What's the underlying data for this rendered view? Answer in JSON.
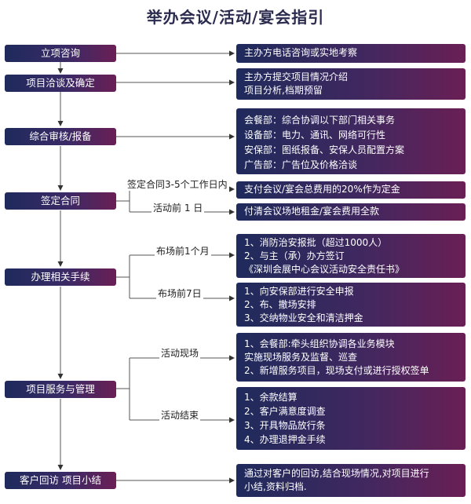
{
  "title": "举办会议/活动/宴会指引",
  "stages": {
    "s1": "立项咨询",
    "s2": "项目洽谈及确定",
    "s3": "综合审核/报备",
    "s4": "签定合同",
    "s5": "办理相关手续",
    "s6": "项目服务与管理",
    "s7": "客户回访  项目小结"
  },
  "boxes": {
    "b1": [
      "主办方电话咨询或实地考察"
    ],
    "b2": [
      "主办方提交项目情况介绍",
      "项目分析,档期预留"
    ],
    "b3": [
      "会餐部：综合协调以下部门相关事务",
      "设备部：电力、通讯、网络可行性",
      "安保部：图纸报备、安保人员配置方案",
      "广告部：广告位及价格洽谈"
    ],
    "b4": [
      "支付会议/宴会总费用的20%作为定金"
    ],
    "b5": [
      "付清会议场地租金/宴会费用全款"
    ],
    "b6": [
      "1、消防治安报批（超过1000人）",
      "2、与主（承）办方签订",
      "  《深圳会展中心会议活动安全责任书》"
    ],
    "b7": [
      "1、向安保部进行安全申报",
      "2、布、撤场安排",
      "3、交纳物业安全和清洁押金"
    ],
    "b8": [
      "1、会餐部:牵头组织协调各业务模块",
      "    实施现场服务及监督、巡查",
      "2、新增服务项目，现场支付或进行授权签单"
    ],
    "b9": [
      "1、余款结算",
      "2、客户满意度调查",
      "3、开具物品放行条",
      "4、办理退押金手续"
    ],
    "b10": [
      "通过对客户的回访,结合现场情况,对项目进行",
      "小结,资料归档."
    ]
  },
  "labels": {
    "l1": "签定合同3-5个工作日内",
    "l2": "活动前 1 日",
    "l3": "布场前1个月",
    "l4": "布场前7日",
    "l5": "活动现场",
    "l6": "活动结束"
  }
}
